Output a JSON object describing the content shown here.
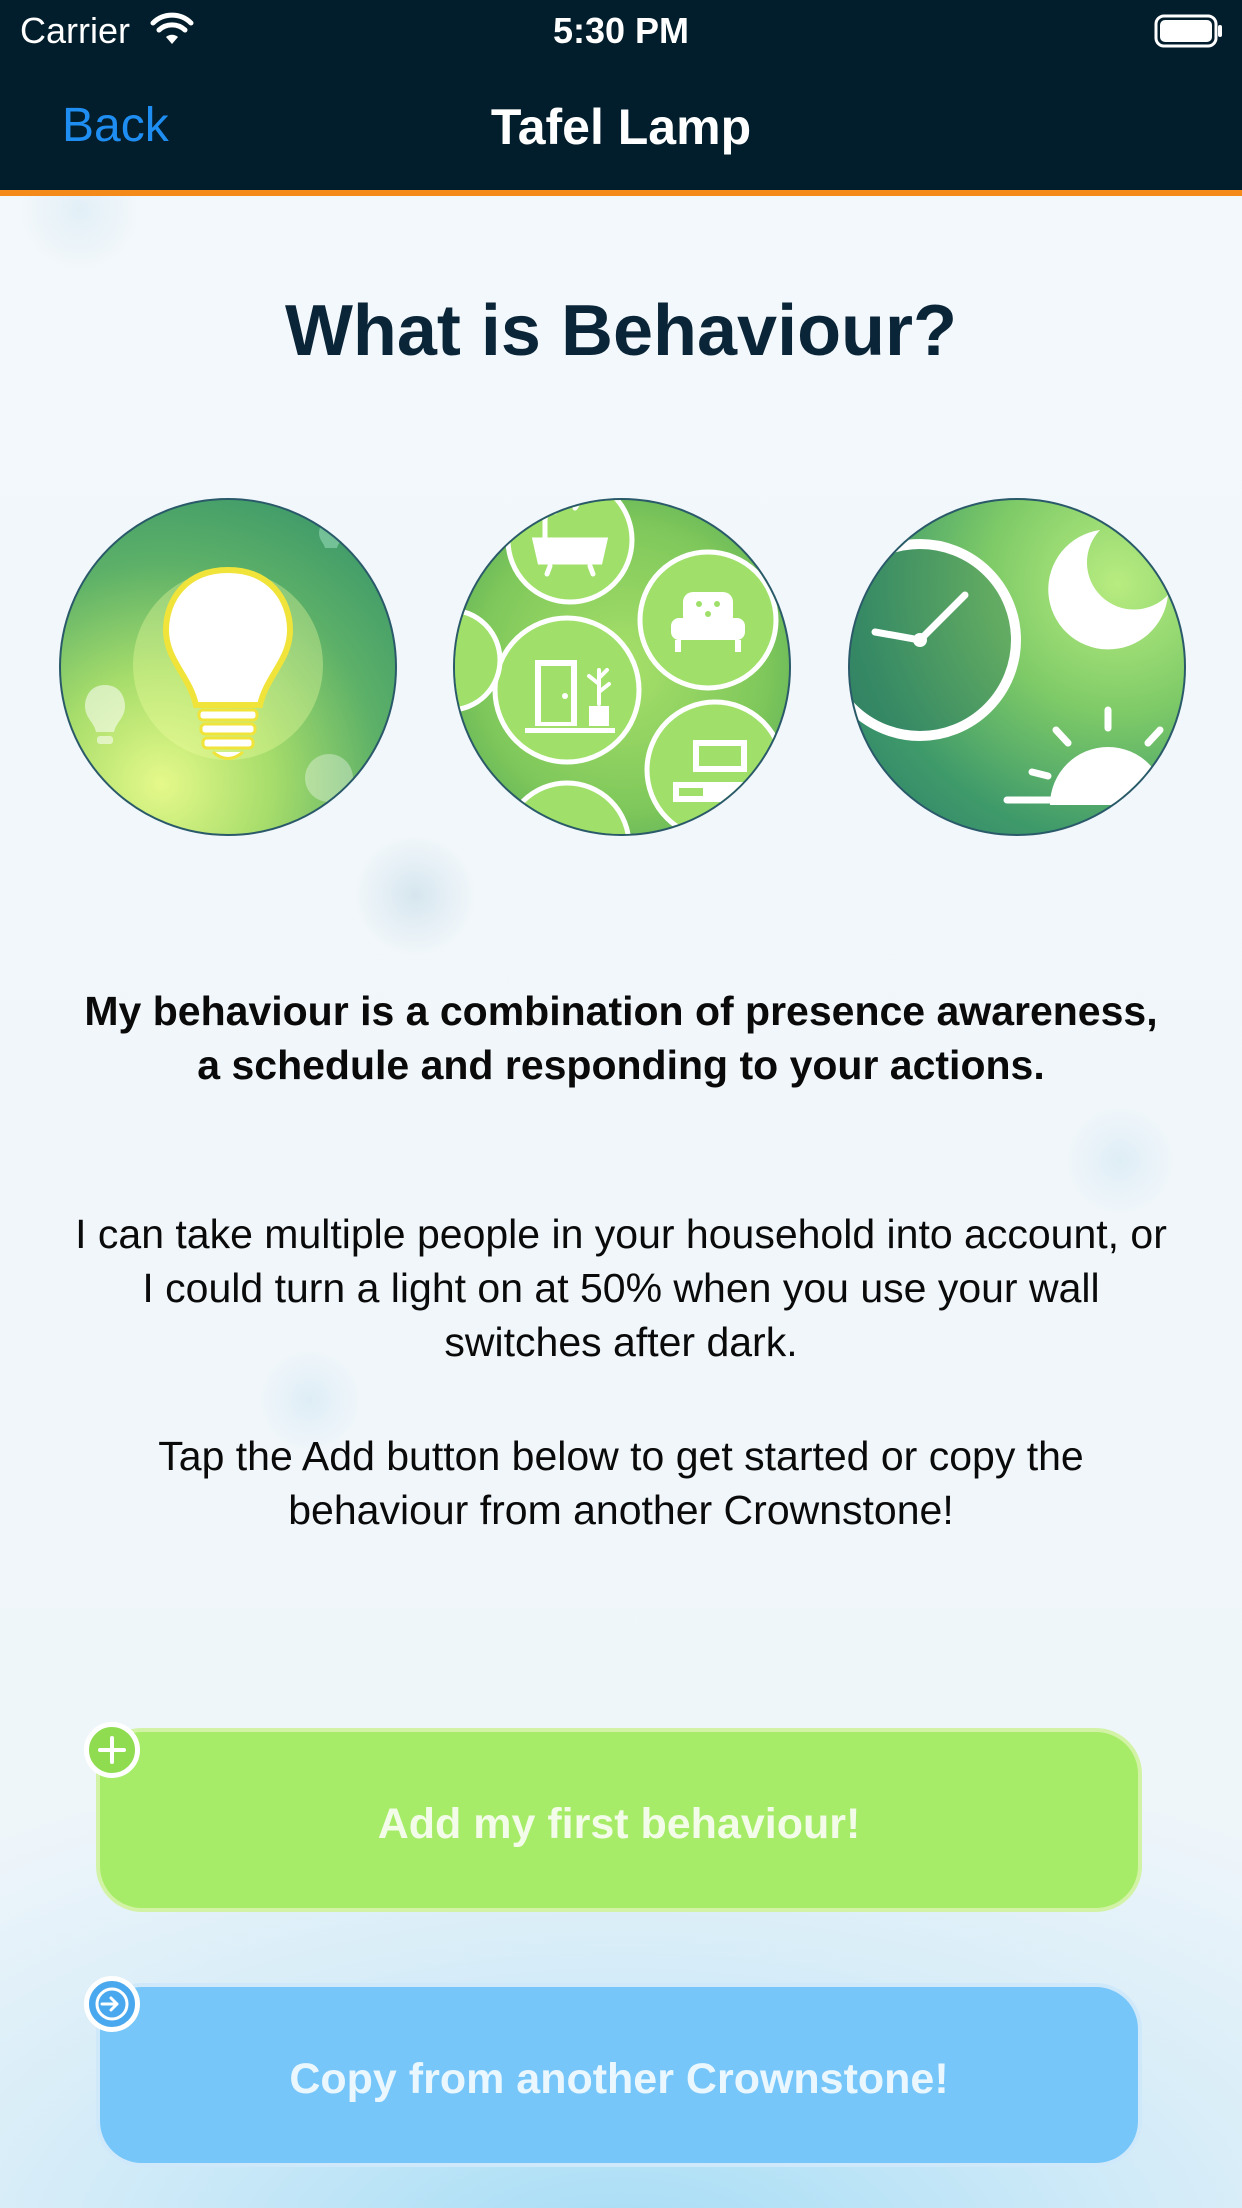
{
  "status_bar": {
    "carrier": "Carrier",
    "time": "5:30 PM"
  },
  "nav": {
    "back_label": "Back",
    "title": "Tafel Lamp"
  },
  "colors": {
    "nav_bg": "#021d2b",
    "accent": "#f48a1a",
    "add_button": "#a7ec68",
    "copy_button": "#76c6fa",
    "back_link": "#1f8ef2"
  },
  "main": {
    "heading": "What is Behaviour?",
    "illustrations": [
      "lightbulb-icon",
      "rooms-icon",
      "clock-moon-sun-icon"
    ],
    "intro_bold": "My behaviour is a combination of presence awareness, a schedule and responding to your actions.",
    "paragraph_2": "I can take multiple people in your household into account, or I could turn a light on at 50% when you use your wall switches after dark.",
    "paragraph_3": "Tap the Add button below to get started or copy the behaviour from another Crownstone!"
  },
  "buttons": {
    "add_label": "Add my first behaviour!",
    "copy_label": "Copy from another Crownstone!"
  }
}
